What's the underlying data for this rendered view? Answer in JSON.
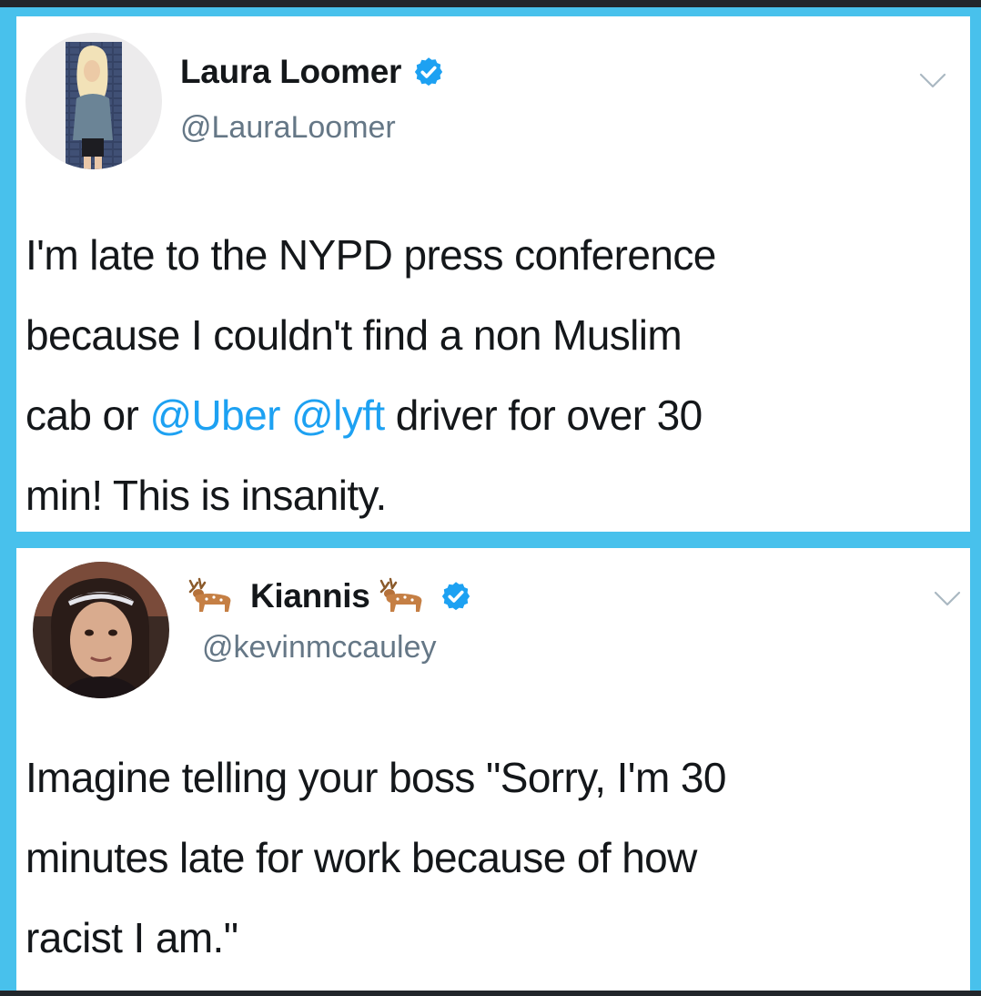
{
  "colors": {
    "frame_blue": "#48c1ec",
    "text": "#14171a",
    "handle_gray": "#657786",
    "link_blue": "#1da1f2",
    "verified_blue": "#1da1f2"
  },
  "tweets": [
    {
      "display_name": "Laura Loomer",
      "handle": "@LauraLoomer",
      "verified": true,
      "avatar_icon": "profile-photo",
      "menu_icon": "chevron-down-icon",
      "lines": [
        {
          "text": "I'm late to the NYPD press conference"
        },
        {
          "text": "because I couldn't find a non Muslim"
        },
        {
          "pre": "cab or ",
          "mention_1": "@Uber",
          "mid": " ",
          "mention_2": "@lyft",
          "post": " driver for over 30"
        },
        {
          "text": "min! This is insanity."
        }
      ]
    },
    {
      "display_name": "Kiannis",
      "name_emoji": "deer-emoji-icon",
      "handle": "@kevinmccauley",
      "verified": true,
      "avatar_icon": "profile-photo",
      "menu_icon": "chevron-down-icon",
      "lines": [
        {
          "text": "Imagine telling your boss \"Sorry, I'm 30"
        },
        {
          "text": "minutes late for work because of how"
        },
        {
          "text": "racist I am.\""
        }
      ]
    }
  ]
}
